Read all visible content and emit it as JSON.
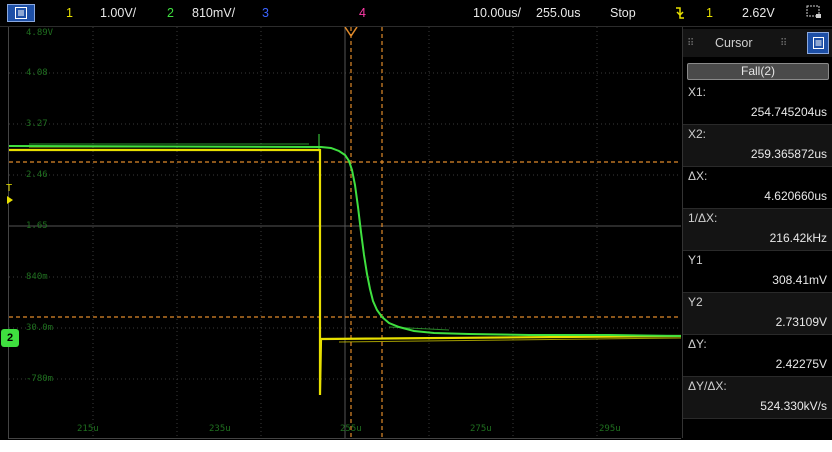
{
  "topbar": {
    "ch1_num": "1",
    "ch1_scale": "1.00V/",
    "ch2_num": "2",
    "ch2_scale": "810mV/",
    "ch3_num": "3",
    "ch4_num": "4",
    "timebase": "10.00us/",
    "delay": "255.0us",
    "run_state": "Stop",
    "trigger_icon": "falling-edge-trigger-icon",
    "trigger_channel": "1",
    "trigger_level": "2.62V"
  },
  "plot": {
    "y_labels": [
      "4.89V",
      "4.08",
      "3.27",
      "2.46",
      "1.65",
      "840m",
      "30.0m",
      "-780m"
    ],
    "x_labels": [
      "215u",
      "235u",
      "255u",
      "275u",
      "295u"
    ],
    "trigger_marker": "T",
    "ground_marker": "2"
  },
  "side_panel": {
    "title": "Cursor",
    "mode": "Fall(2)",
    "rows": [
      {
        "label": "X1:",
        "value": "254.745204us"
      },
      {
        "label": "X2:",
        "value": "259.365872us"
      },
      {
        "label": "ΔX:",
        "value": "4.620660us"
      },
      {
        "label": "1/ΔX:",
        "value": "216.42kHz"
      },
      {
        "label": "Y1",
        "value": "308.41mV"
      },
      {
        "label": "Y2",
        "value": "2.73109V"
      },
      {
        "label": "ΔY:",
        "value": "2.42275V"
      },
      {
        "label": "ΔY/ΔX:",
        "value": "524.330kV/s"
      }
    ]
  },
  "colors": {
    "ch1": "#e8e000",
    "ch2": "#3fe03f",
    "ch3": "#3a63ff",
    "ch4": "#ff3aa8",
    "cursor": "#e08a2a",
    "grid": "#3a3a3a",
    "accent": "#1d4fa6"
  }
}
